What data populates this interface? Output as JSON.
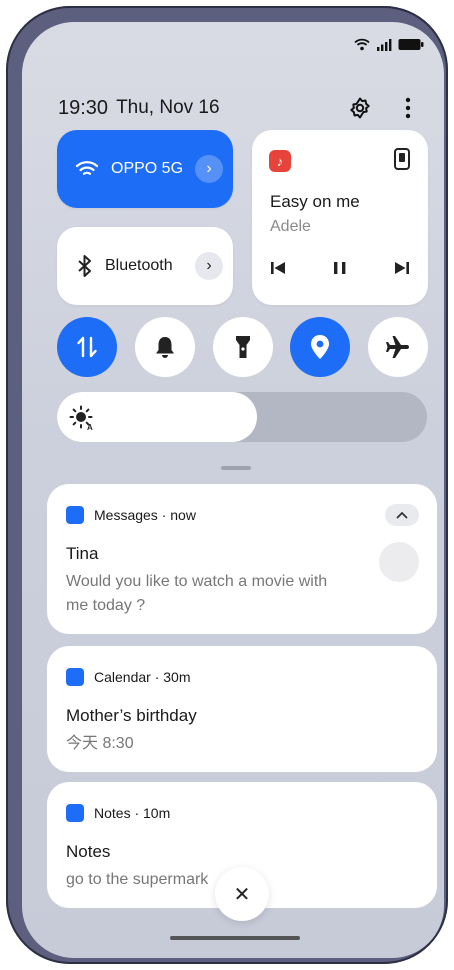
{
  "header": {
    "time": "19:30",
    "date": "Thu, Nov 16"
  },
  "tiles": {
    "wifi": {
      "label": "OPPO 5G",
      "icon": "wifi-icon",
      "color": "#1e6df6"
    },
    "bluetooth": {
      "label": "Bluetooth",
      "icon": "bluetooth-icon"
    },
    "media": {
      "song": "Easy on me",
      "artist": "Adele",
      "app_icon": "music-app-icon",
      "device_icon": "phone-device-icon"
    }
  },
  "toggles": [
    {
      "name": "mobile-data",
      "icon": "data-transfer-icon",
      "on": true
    },
    {
      "name": "ring",
      "icon": "bell-icon",
      "on": false
    },
    {
      "name": "flashlight",
      "icon": "flashlight-icon",
      "on": false
    },
    {
      "name": "location",
      "icon": "location-icon",
      "on": true
    },
    {
      "name": "airplane-mode",
      "icon": "airplane-icon",
      "on": false
    }
  ],
  "brightness": {
    "level": 0.54,
    "icon": "auto-brightness-icon"
  },
  "notifications": [
    {
      "app": "Messages · now",
      "title": "Tina",
      "body_line1": "Would you like to watch a movie with",
      "body_line2": "me today ?"
    },
    {
      "app": "Calendar · 30m",
      "title": "Mother’s birthday",
      "body": "今天 8:30"
    },
    {
      "app": "Notes · 10m",
      "title": "Notes",
      "body": "go to the supermark"
    }
  ],
  "dismiss": {
    "label": "✕"
  },
  "accent": "#1e6df6"
}
